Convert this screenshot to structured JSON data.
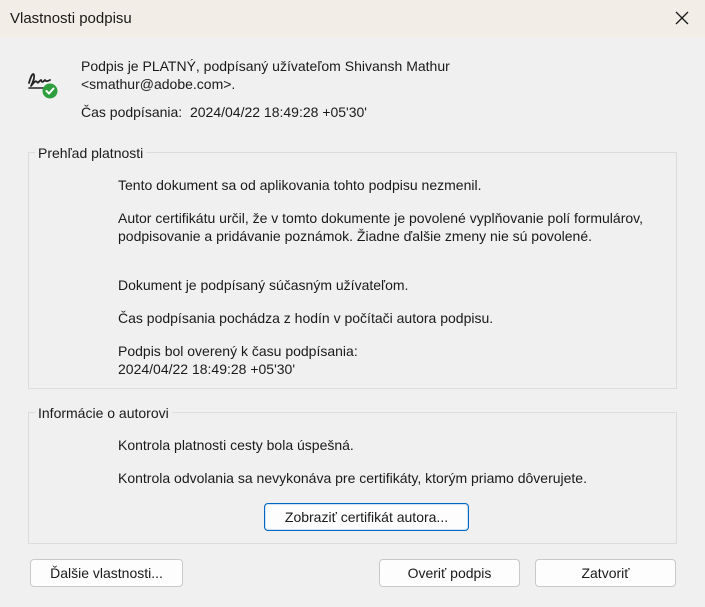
{
  "window": {
    "title": "Vlastnosti podpisu"
  },
  "signature": {
    "status_line1": "Podpis je PLATNÝ, podpísaný užívateľom Shivansh Mathur",
    "status_line2": "<smathur@adobe.com>.",
    "time_label": "Čas podpísania:",
    "time_value": "2024/04/22 18:49:28 +05'30'"
  },
  "validity": {
    "legend": "Prehľad platnosti",
    "paragraphs": [
      "Tento dokument sa od aplikovania tohto podpisu nezmenil.",
      "Autor certifikátu určil, že v tomto dokumente je povolené vyplňovanie polí formulárov, podpisovanie a pridávanie poznámok. Žiadne ďalšie zmeny nie sú povolené.",
      "Dokument je podpísaný súčasným užívateľom.",
      "Čas podpísania pochádza z hodín v počítači autora podpisu.",
      "Podpis bol overený k času podpísania:",
      "2024/04/22 18:49:28 +05'30'"
    ]
  },
  "signer": {
    "legend": "Informácie o autorovi",
    "paragraphs": [
      "Kontrola platnosti cesty bola úspešná.",
      "Kontrola odvolania sa nevykonáva pre certifikáty, ktorým priamo dôverujete."
    ],
    "show_cert_label": "Zobraziť certifikát autora..."
  },
  "footer": {
    "more_props_label": "Ďalšie vlastnosti...",
    "verify_label": "Overiť podpis",
    "close_label": "Zatvoriť"
  },
  "colors": {
    "valid_green": "#2e9e3e",
    "accent_blue": "#0067c0"
  },
  "icons": {
    "signature": "signature-valid-icon",
    "close": "close-icon"
  }
}
